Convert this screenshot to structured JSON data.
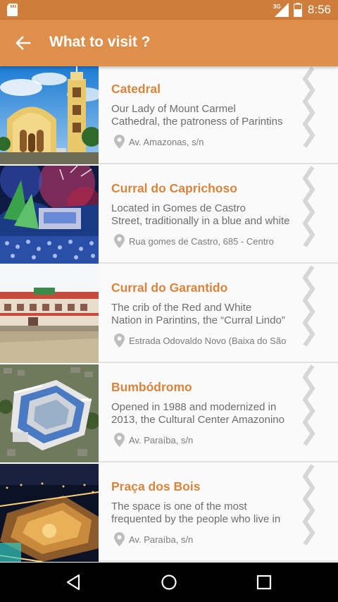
{
  "status_bar": {
    "time": "8:56",
    "network_label": "3G",
    "icons": [
      "sd-card-icon",
      "network-signal-icon",
      "battery-icon"
    ]
  },
  "app_bar": {
    "title": "What to visit ?",
    "back_icon": "arrow-left-icon"
  },
  "colors": {
    "status_bar": "#cf7d3a",
    "app_bar": "#df8f4c",
    "accent_text": "#d9843d",
    "body_text": "#6d6d6d",
    "chevron": "#d6d6d6"
  },
  "places": [
    {
      "name": "Catedral",
      "description_lines": [
        "Our Lady of Mount Carmel",
        "Cathedral, the patroness of Parintins"
      ],
      "address": "Av. Amazonas, s/n",
      "image": "cathedral-photo"
    },
    {
      "name": "Curral do Caprichoso",
      "description_lines": [
        "Located in Gomes de Castro",
        "Street, traditionally in a blue and white"
      ],
      "address": "Rua gomes de Castro, 685 - Centro",
      "image": "caprichoso-festival-photo"
    },
    {
      "name": "Curral do Garantido",
      "description_lines": [
        "The crib of the Red and White",
        "Nation in Parintins, the “Curral Lindo”"
      ],
      "address": "Estrada Odovaldo Novo (Baixa do São",
      "image": "garantido-building-photo"
    },
    {
      "name": "Bumbódromo",
      "description_lines": [
        "Opened in 1988 and modernized in",
        "2013, the Cultural Center Amazonino"
      ],
      "address": "Av. Paraíba, s/n",
      "image": "bumbodromo-aerial-photo"
    },
    {
      "name": "Praça dos Bois",
      "description_lines": [
        "The space is one of the most",
        "frequented by the people who live in"
      ],
      "address": "Av. Paraíba, s/n",
      "image": "praca-night-aerial-photo"
    }
  ],
  "nav_bar": {
    "buttons": [
      "back-triangle-icon",
      "home-circle-icon",
      "recents-square-icon"
    ]
  }
}
